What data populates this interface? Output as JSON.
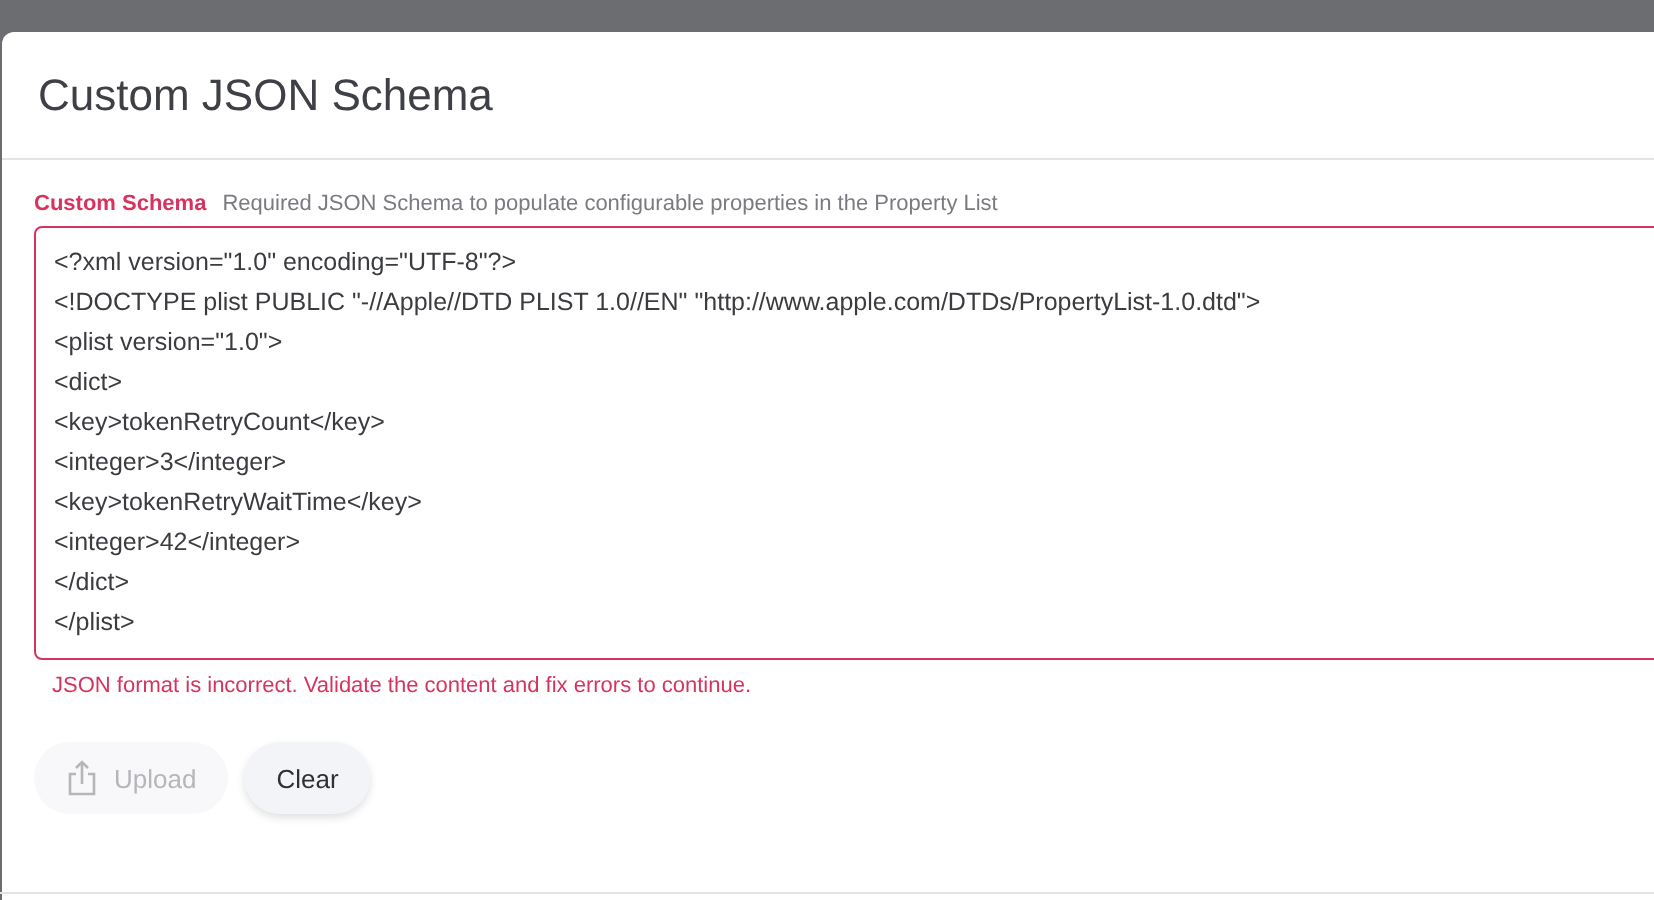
{
  "dialog": {
    "title": "Custom JSON Schema",
    "field": {
      "label": "Custom Schema",
      "hint": "Required JSON Schema to populate configurable properties in the Property List",
      "invalid": true,
      "lines": [
        "<?xml version=\"1.0\" encoding=\"UTF-8\"?>",
        "<!DOCTYPE plist PUBLIC \"-//Apple//DTD PLIST 1.0//EN\" \"http://www.apple.com/DTDs/PropertyList-1.0.dtd\">",
        "<plist version=\"1.0\">",
        "<dict>",
        "<key>tokenRetryCount</key>",
        "<integer>3</integer>",
        "<key>tokenRetryWaitTime</key>",
        "<integer>42</integer>",
        "</dict>",
        "</plist>"
      ],
      "error": "JSON format is incorrect. Validate the content and fix errors to continue."
    },
    "buttons": [
      {
        "kind": "upload",
        "label": "Upload",
        "disabled": true
      },
      {
        "kind": "plain",
        "label": "Clear",
        "disabled": false
      }
    ]
  }
}
